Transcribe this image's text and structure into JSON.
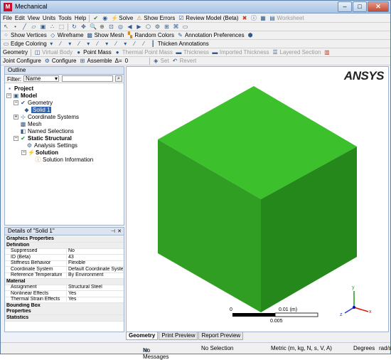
{
  "window": {
    "title": "Mechanical",
    "app_icon": "M",
    "minimize": "–",
    "maximize": "□",
    "close": "✕"
  },
  "menu": [
    "File",
    "Edit",
    "View",
    "Units",
    "Tools",
    "Help"
  ],
  "toolbar1": {
    "solve": "Solve",
    "show_errors": "Show Errors",
    "review_model": "Review Model (Beta)",
    "worksheet": "Worksheet"
  },
  "toolbar2": {
    "show_vertices": "Show Vertices",
    "wireframe": "Wireframe",
    "show_mesh": "Show Mesh",
    "random_colors": "Random Colors",
    "annotation_preferences": "Annotation Preferences"
  },
  "toolbar3": {
    "edge_coloring": "Edge Coloring",
    "thicken_annotations": "Thicken Annotations"
  },
  "toolbar4": {
    "geometry": "Geometry",
    "virtual_body": "Virtual Body",
    "point_mass": "Point Mass",
    "thermal_point_mass": "Thermal Point Mass",
    "thickness": "Thickness",
    "imported_thickness": "Imported Thickness",
    "layered_section": "Layered Section"
  },
  "toolbar5": {
    "joint_configure": "Joint Configure",
    "configure": "Configure",
    "assemble": "Assemble",
    "delta_label": "Δ=",
    "delta_value": "0",
    "set": "Set",
    "revert": "Revert"
  },
  "outline": {
    "title": "Outline",
    "filter_label": "Filter:",
    "filter_value": "Name",
    "tree": [
      "Project",
      "Model",
      "Geometry",
      "Solid 1",
      "Coordinate Systems",
      "Mesh",
      "Named Selections",
      "Static Structural",
      "Analysis Settings",
      "Solution",
      "Solution Information"
    ]
  },
  "details": {
    "title": "Details of \"Solid 1\"",
    "rows": [
      {
        "group": "Graphics Properties"
      },
      {
        "group": "Definition"
      },
      {
        "k": "Suppressed",
        "v": "No"
      },
      {
        "k": "ID (Beta)",
        "v": "43"
      },
      {
        "k": "Stiffness Behavior",
        "v": "Flexible"
      },
      {
        "k": "Coordinate System",
        "v": "Default Coordinate System"
      },
      {
        "k": "Reference Temperature",
        "v": "By Environment"
      },
      {
        "group": "Material"
      },
      {
        "k": "Assignment",
        "v": "Structural Steel"
      },
      {
        "k": "Nonlinear Effects",
        "v": "Yes"
      },
      {
        "k": "Thermal Strain Effects",
        "v": "Yes"
      },
      {
        "group": "Bounding Box"
      },
      {
        "group": "Properties"
      },
      {
        "group": "Statistics"
      }
    ]
  },
  "viewport": {
    "logo": "ANSYS",
    "scale_zero": "0",
    "scale_end": "0.01 (m)",
    "scale_mid": "0.005",
    "axis_x": "x",
    "axis_y": "y",
    "axis_z": "z",
    "cube_front": "#2f9e23",
    "cube_top": "#3cc12d",
    "cube_side": "#24881b"
  },
  "tabs": [
    "Geometry",
    "Print Preview",
    "Report Preview"
  ],
  "status": {
    "messages": "No Messages",
    "selection": "No Selection",
    "units": "Metric (m, kg, N, s, V, A)",
    "angle": "Degrees",
    "rad": "rad/s"
  }
}
